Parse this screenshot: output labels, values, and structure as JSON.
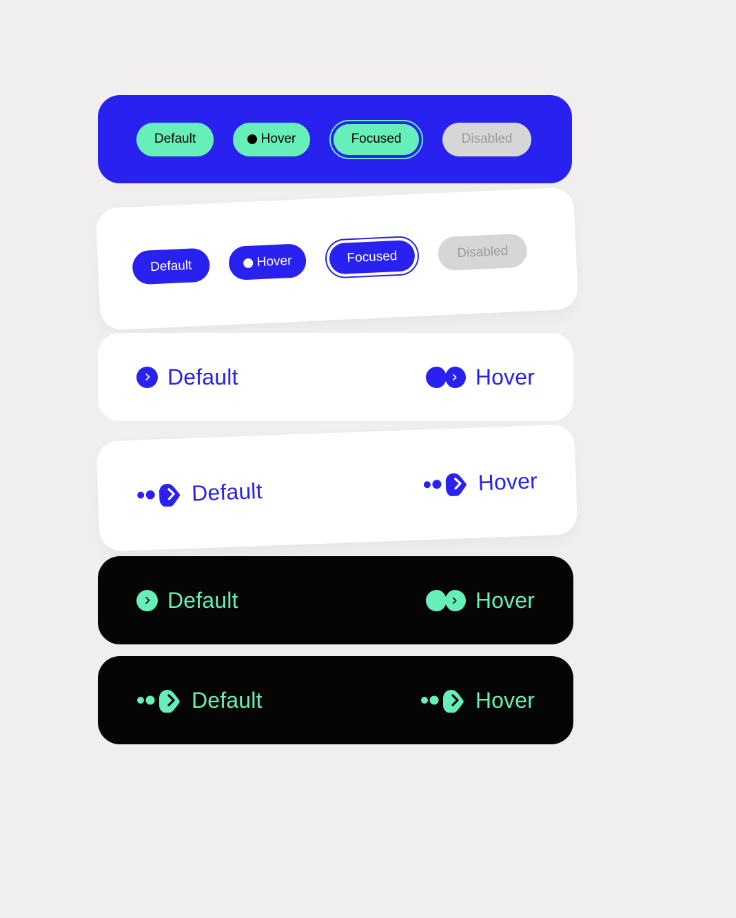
{
  "colors": {
    "blue": "#2921ef",
    "mint": "#66efb9",
    "black": "#050505",
    "grey": "#d6d6d6",
    "grey_text": "#9b9b9b",
    "white": "#ffffff",
    "page_bg": "#f0efee"
  },
  "panel1": {
    "default": "Default",
    "hover": "Hover",
    "focused": "Focused",
    "disabled": "Disabled"
  },
  "panel2": {
    "default": "Default",
    "hover": "Hover",
    "focused": "Focused",
    "disabled": "Disabled"
  },
  "panel3": {
    "default": "Default",
    "hover": "Hover"
  },
  "panel4": {
    "default": "Default",
    "hover": "Hover"
  },
  "panel5": {
    "default": "Default",
    "hover": "Hover"
  },
  "panel6": {
    "default": "Default",
    "hover": "Hover"
  }
}
